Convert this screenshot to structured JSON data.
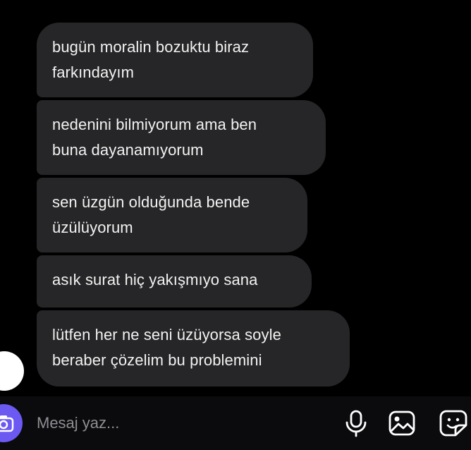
{
  "messages": [
    {
      "lines": [
        "bugün moralin bozuktu biraz",
        "farkındayım"
      ]
    },
    {
      "lines": [
        "nedenini bilmiyorum ama ben",
        "buna dayanamıyorum"
      ]
    },
    {
      "lines": [
        "sen üzgün olduğunda bende",
        "üzülüyorum"
      ]
    },
    {
      "lines": [
        "asık surat hiç yakışmıyo sana"
      ]
    },
    {
      "lines": [
        "lütfen her ne seni üzüyorsa soyle",
        "beraber çözelim bu problemini"
      ]
    }
  ],
  "composer": {
    "placeholder": "Mesaj yaz...",
    "camera_icon": "camera-icon",
    "mic_icon": "microphone-icon",
    "gallery_icon": "image-icon",
    "sticker_icon": "sticker-icon",
    "accent_color": "#6b59f2"
  },
  "colors": {
    "background": "#000000",
    "bubble": "#262628",
    "text": "#f2f2f2"
  }
}
